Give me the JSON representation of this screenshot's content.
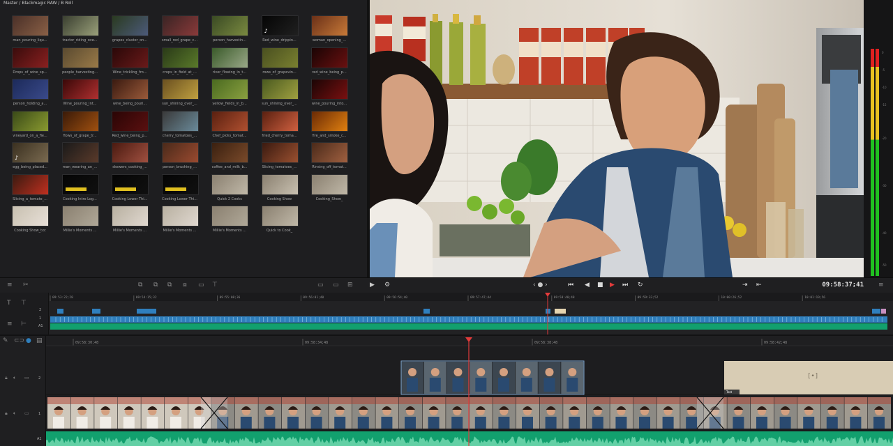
{
  "pool": {
    "breadcrumb": "Master / Blackmagic RAW / B Roll",
    "clips": [
      {
        "label": "man_pouring_liqu...",
        "c1": "#4a3028",
        "c2": "#8a6046"
      },
      {
        "label": "tractor_riding_ove...",
        "c1": "#3a3f30",
        "c2": "#9aa07a"
      },
      {
        "label": "grapes_cluster_on...",
        "c1": "#2a3a20",
        "c2": "#4c5a7a"
      },
      {
        "label": "small_red_grape_c...",
        "c1": "#3a2424",
        "c2": "#8a3a3a"
      },
      {
        "label": "person_harvestin...",
        "c1": "#3a4a24",
        "c2": "#7a8a40"
      },
      {
        "label": "Red_wine_drippin...",
        "c1": "#050505",
        "c2": "#202020",
        "icon": "music"
      },
      {
        "label": "woman_opening_...",
        "c1": "#6a3018",
        "c2": "#c87a38"
      },
      {
        "label": "Drops_of_wine_sp...",
        "c1": "#3a0c0c",
        "c2": "#8a2020"
      },
      {
        "label": "people_harvesting...",
        "c1": "#5a4a30",
        "c2": "#9a7a48"
      },
      {
        "label": "Wine_trickling_fro...",
        "c1": "#2a0808",
        "c2": "#6a1a1a"
      },
      {
        "label": "crops_in_field_at_...",
        "c1": "#2a3a18",
        "c2": "#5a7a2a"
      },
      {
        "label": "river_flowing_in_t...",
        "c1": "#3a5a2a",
        "c2": "#9aa888"
      },
      {
        "label": "rows_of_grapevin...",
        "c1": "#4a5020",
        "c2": "#7a8030"
      },
      {
        "label": "red_wine_being_p...",
        "c1": "#1a0404",
        "c2": "#6a1010"
      },
      {
        "label": "person_holding_a...",
        "c1": "#1c2a5a",
        "c2": "#3a4a8a"
      },
      {
        "label": "Wine_pouring_int...",
        "c1": "#3a0808",
        "c2": "#b03030"
      },
      {
        "label": "wine_being_pouri...",
        "c1": "#3a1a10",
        "c2": "#9a5a3a"
      },
      {
        "label": "sun_shining_over_...",
        "c1": "#6a5020",
        "c2": "#c0a040"
      },
      {
        "label": "yellow_fields_in_b...",
        "c1": "#4a6a20",
        "c2": "#8aa040"
      },
      {
        "label": "sun_shining_over_...",
        "c1": "#4a5a20",
        "c2": "#a0a040"
      },
      {
        "label": "wine_pouring_into...",
        "c1": "#1a0505",
        "c2": "#7a1010"
      },
      {
        "label": "vineyard_on_a_fie...",
        "c1": "#3a4a18",
        "c2": "#8a9a30"
      },
      {
        "label": "flows_of_grape_tr...",
        "c1": "#3a1a08",
        "c2": "#a05010"
      },
      {
        "label": "Red_wine_being_p...",
        "c1": "#2a0505",
        "c2": "#5a1010"
      },
      {
        "label": "cherry_tomatoes_...",
        "c1": "#3a3a3a",
        "c2": "#6a8a9a"
      },
      {
        "label": "Chef_picks_tomat...",
        "c1": "#5a2010",
        "c2": "#b05030"
      },
      {
        "label": "fried_cherry_toma...",
        "c1": "#5a2010",
        "c2": "#d06040"
      },
      {
        "label": "fire_and_smoke_c...",
        "c1": "#6a2a05",
        "c2": "#e08010"
      },
      {
        "label": "egg_being_placed...",
        "c1": "#3a3020",
        "c2": "#7a6a50",
        "icon": "music"
      },
      {
        "label": "man_wearing_an_...",
        "c1": "#1a1a1a",
        "c2": "#5a3a2a"
      },
      {
        "label": "skewers_cooking_...",
        "c1": "#4a1a10",
        "c2": "#a05040"
      },
      {
        "label": "person_brushing_...",
        "c1": "#4a2a1a",
        "c2": "#9a4a30"
      },
      {
        "label": "coffee_and_milk_b...",
        "c1": "#3a2010",
        "c2": "#7a4a2a"
      },
      {
        "label": "Slicing_tomatoes_...",
        "c1": "#3a1a10",
        "c2": "#9a5030"
      },
      {
        "label": "Rinsing_off_tomat...",
        "c1": "#4a2a1a",
        "c2": "#a06040"
      },
      {
        "label": "Slicing_a_tomato_...",
        "c1": "#3a1a10",
        "c2": "#c03020"
      },
      {
        "label": "Cooking Intro Log...",
        "c1": "#050505",
        "c2": "#101010",
        "bar": "#e0c020"
      },
      {
        "label": "Cooking Lower Thi...",
        "c1": "#050505",
        "c2": "#101010",
        "bar": "#e0c020"
      },
      {
        "label": "Cooking Lower Thi...",
        "c1": "#050505",
        "c2": "#101010",
        "bar": "#e0c020"
      },
      {
        "label": "Quick 2 Cooks",
        "c1": "#8a8070",
        "c2": "#c0b8a8"
      },
      {
        "label": "Cooking Show",
        "c1": "#8a8070",
        "c2": "#c8c0b0"
      },
      {
        "label": "Cooking_Show_",
        "c1": "#8a8070",
        "c2": "#c0b8a8"
      },
      {
        "label": "Cooking Show_txc",
        "c1": "#c8c0b0",
        "c2": "#e8e0d8"
      },
      {
        "label": "Millie's Moments ...",
        "c1": "#8a8070",
        "c2": "#b0a898"
      },
      {
        "label": "Millie's Moments ...",
        "c1": "#b8b0a0",
        "c2": "#e0d8d0"
      },
      {
        "label": "Millie's Moments ...",
        "c1": "#b8b0a0",
        "c2": "#e0d8d0"
      },
      {
        "label": "Millie's Moments ...",
        "c1": "#8a8070",
        "c2": "#b0a898"
      },
      {
        "label": "Quick to Cook_",
        "c1": "#8a8070",
        "c2": "#c0b8a8"
      }
    ]
  },
  "meters": {
    "ticks": [
      "0",
      "-5",
      "-10",
      "-15",
      "-20",
      "-30",
      "-40",
      "-50"
    ]
  },
  "transport": {
    "timecode": "09:58:37;41"
  },
  "upper_ruler": [
    "09:53:22;28",
    "09:54:15;32",
    "09:55:08;36",
    "09:56:01;40",
    "09:56:54;40",
    "09:57:47;44",
    "09:58:40;48",
    "09:59:33;52",
    "10:00:26;52",
    "10:01:19;56"
  ],
  "lower_ruler": [
    "09:58:30;48",
    "09:58:34;48",
    "09:58:38;48",
    "09:58:42;48"
  ],
  "tracks": {
    "v2": "2",
    "v1": "1",
    "a1": "A1",
    "title_clip_label": "Text"
  },
  "colors": {
    "accent_red": "#e23b3b",
    "video_blue": "#2f7fbd",
    "audio_green": "#12a06e"
  }
}
